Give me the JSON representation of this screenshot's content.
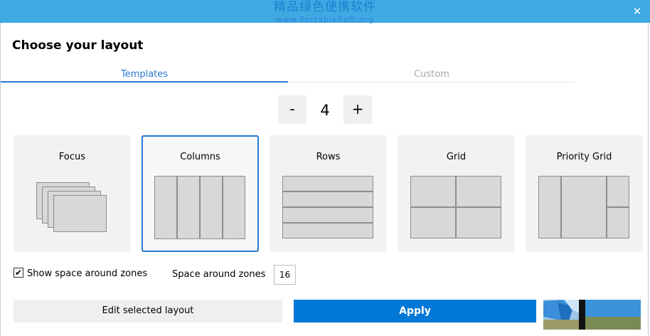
{
  "watermark": {
    "chinese": "精品绿色便携软件",
    "url": "www.PortableSoft.org"
  },
  "window": {
    "close_glyph": "✕"
  },
  "page_title": "Choose your layout",
  "tabs": [
    {
      "label": "Templates",
      "active": true
    },
    {
      "label": "Custom",
      "active": false
    }
  ],
  "zone_count": {
    "minus_label": "-",
    "value": "4",
    "plus_label": "+"
  },
  "layouts": [
    {
      "label": "Focus",
      "selected": false
    },
    {
      "label": "Columns",
      "selected": true
    },
    {
      "label": "Rows",
      "selected": false
    },
    {
      "label": "Grid",
      "selected": false
    },
    {
      "label": "Priority Grid",
      "selected": false
    }
  ],
  "options": {
    "show_space_label": "Show space around zones",
    "show_space_checked": true,
    "check_glyph": "✔",
    "space_label": "Space around zones",
    "space_value": "16"
  },
  "buttons": {
    "edit": "Edit selected layout",
    "apply": "Apply"
  },
  "colors": {
    "accent": "#0078d7",
    "titlebar": "#3fa9e3",
    "tab_active": "#2878d4"
  }
}
